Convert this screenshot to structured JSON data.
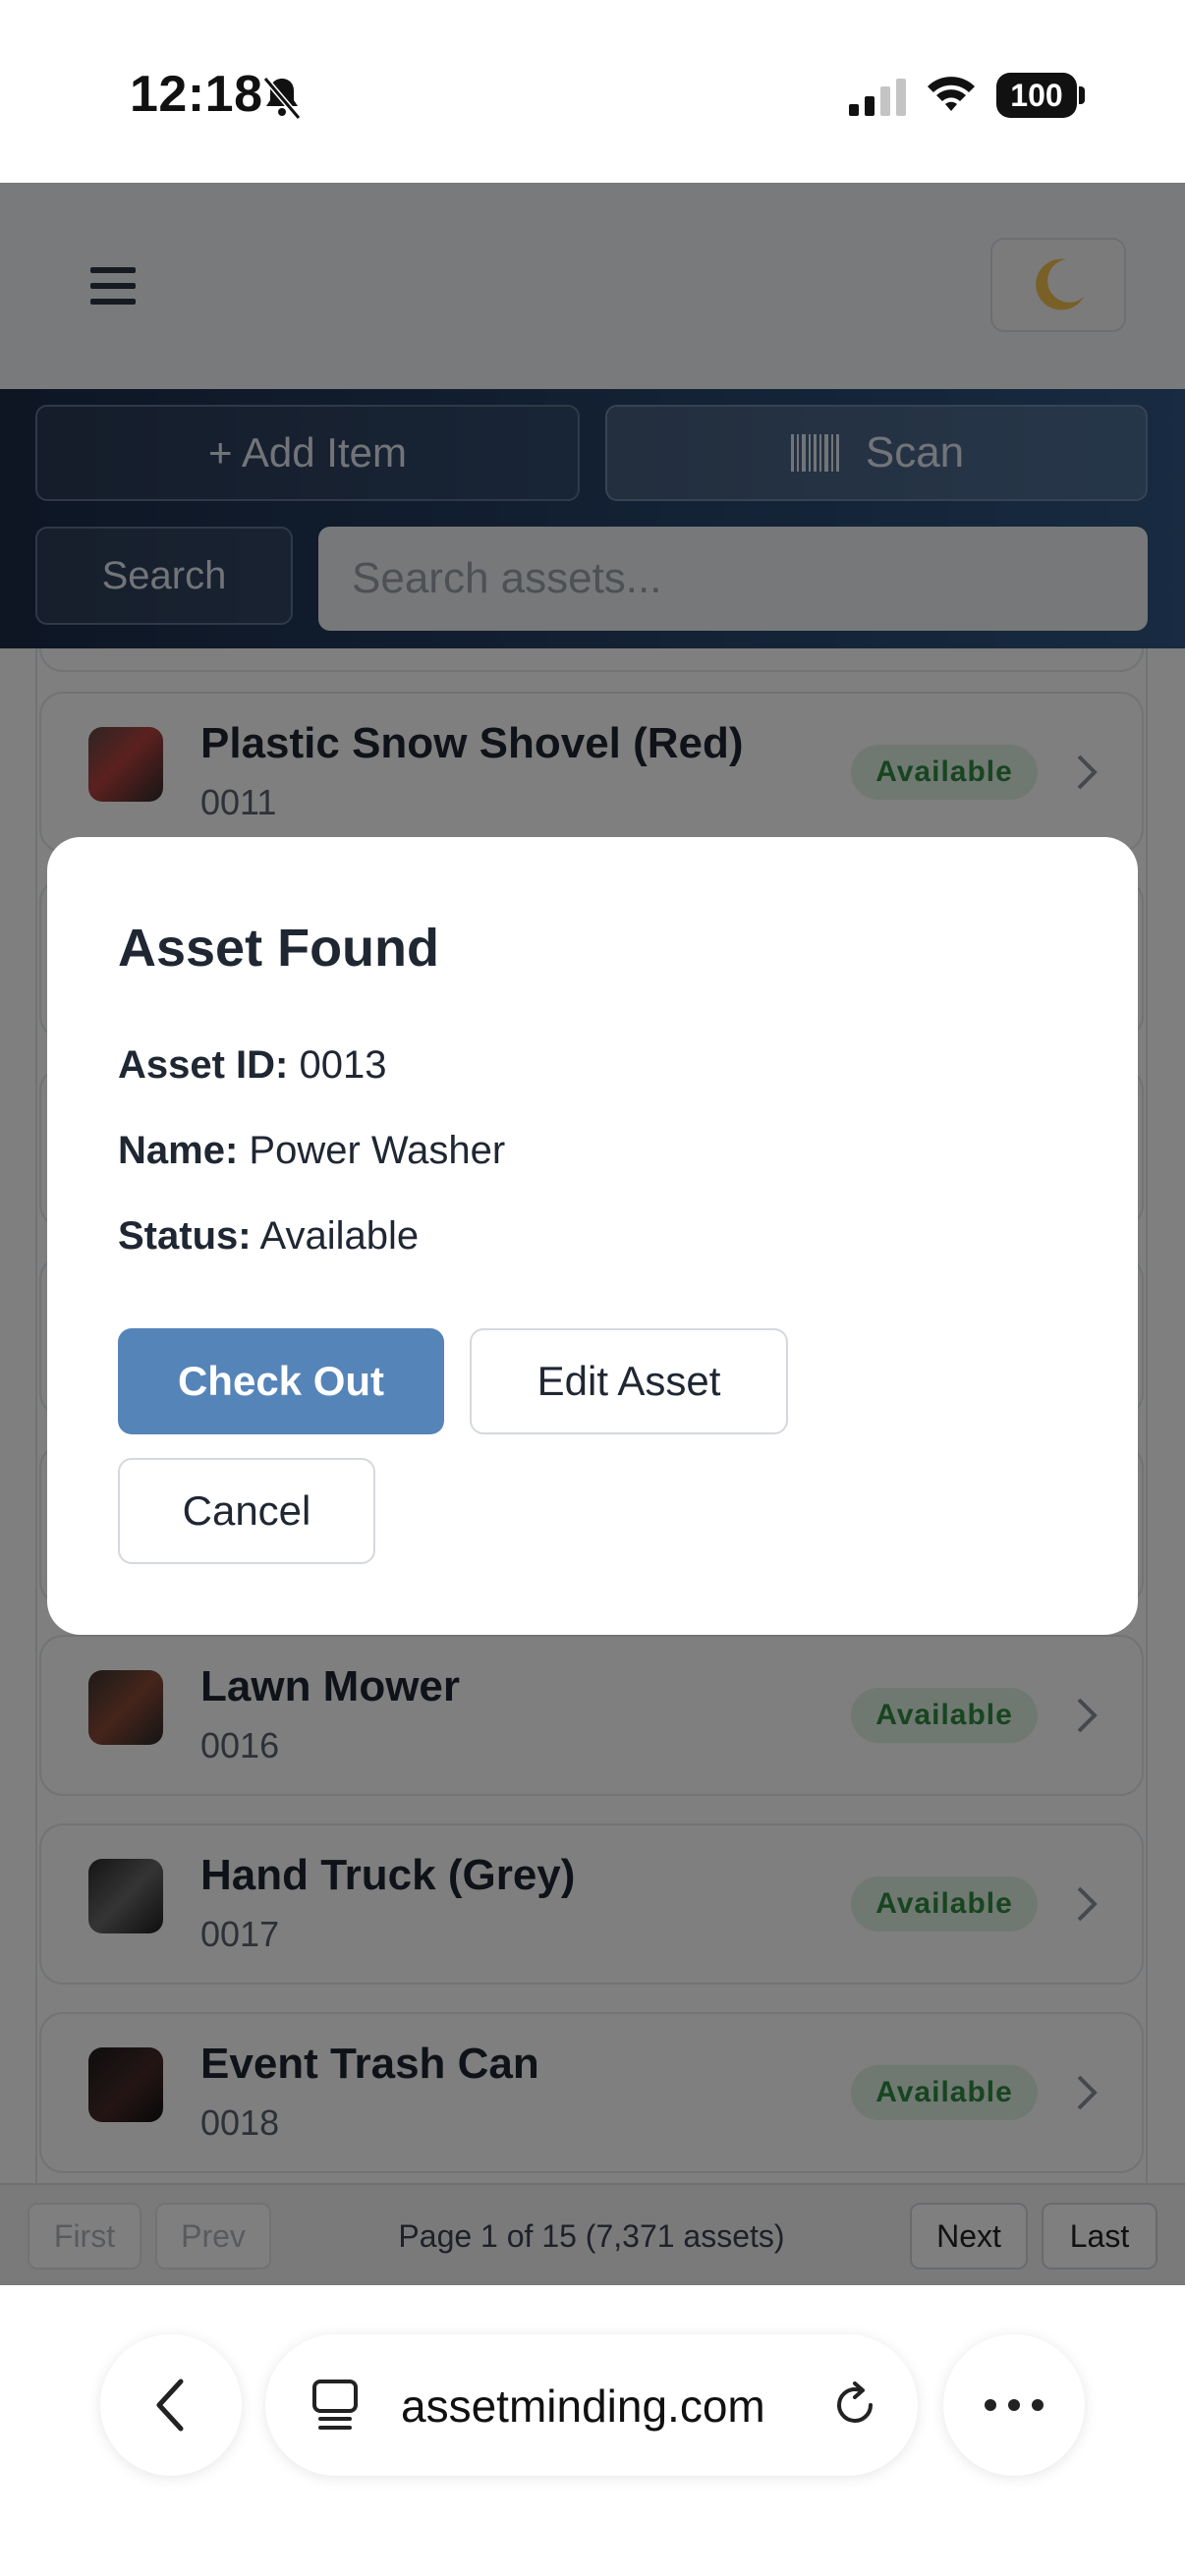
{
  "status_bar": {
    "time": "12:18",
    "battery": "100",
    "icons": [
      "bell-slash-icon",
      "cellular-signal-icon",
      "wifi-icon",
      "battery-icon"
    ]
  },
  "header": {
    "menu_icon": "hamburger-menu-icon",
    "theme_icon": "moon-icon"
  },
  "toolbar": {
    "add_label": "+ Add Item",
    "scan_label": "Scan",
    "scan_icon": "barcode-icon",
    "search_label": "Search",
    "search_placeholder": "Search assets..."
  },
  "assets": [
    {
      "name": "Plastic Snow Shovel (Red)",
      "id": "0011",
      "status": "Available"
    },
    {
      "name": "Lawn Mower",
      "id": "0016",
      "status": "Available"
    },
    {
      "name": "Hand Truck (Grey)",
      "id": "0017",
      "status": "Available"
    },
    {
      "name": "Event Trash Can",
      "id": "0018",
      "status": "Available"
    }
  ],
  "pagination": {
    "first": "First",
    "prev": "Prev",
    "info": "Page 1 of 15 (7,371 assets)",
    "next": "Next",
    "last": "Last"
  },
  "modal": {
    "title": "Asset Found",
    "asset_id_label": "Asset ID:",
    "asset_id_value": "0013",
    "name_label": "Name:",
    "name_value": "Power Washer",
    "status_label": "Status:",
    "status_value": "Available",
    "checkout_label": "Check Out",
    "edit_label": "Edit Asset",
    "cancel_label": "Cancel"
  },
  "browser": {
    "url": "assetminding.com"
  },
  "colors": {
    "toolbar_start": "#1c2c48",
    "toolbar_end": "#2f5683",
    "primary_button": "#5584b8",
    "status_available_bg": "#e1f1e4",
    "status_available_text": "#2e8a3e"
  }
}
